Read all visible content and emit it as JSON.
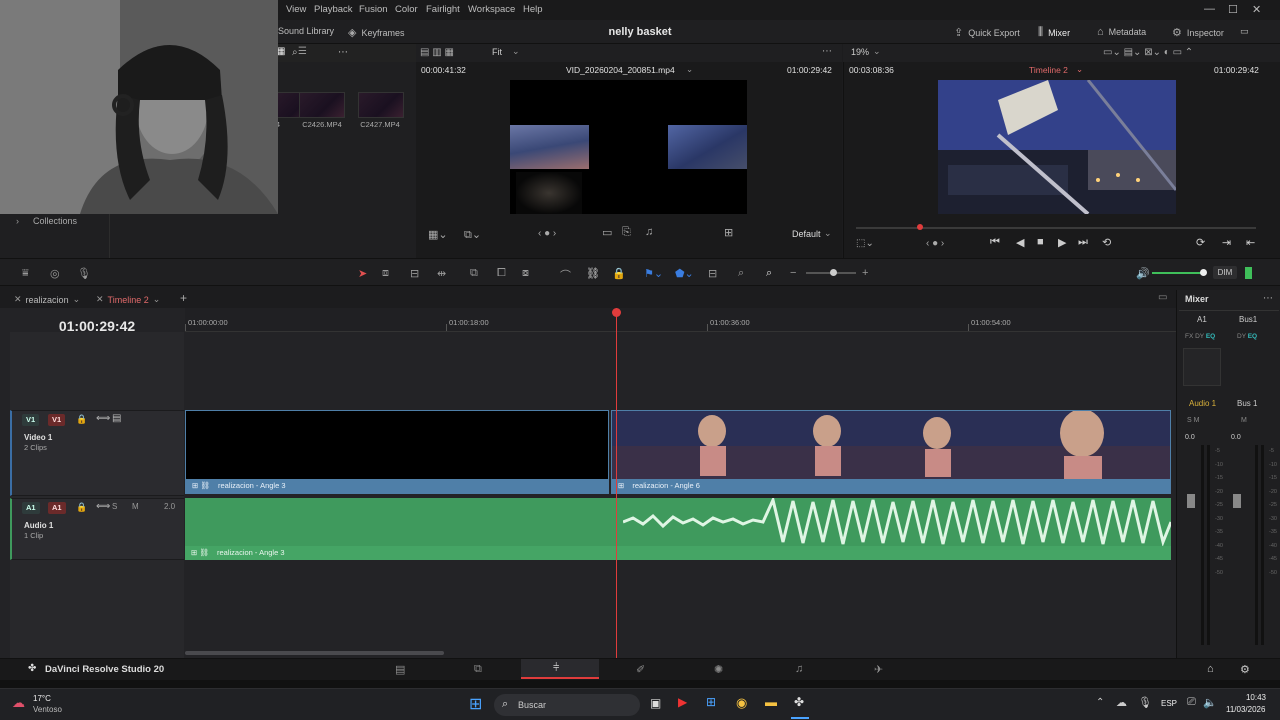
{
  "menu": [
    "View",
    "Playback",
    "Fusion",
    "Color",
    "Fairlight",
    "Workspace",
    "Help"
  ],
  "toolbar": {
    "sound_library": "Sound Library",
    "keyframes": "Keyframes",
    "project_title": "nelly basket",
    "quick_export": "Quick Export",
    "mixer": "Mixer",
    "metadata": "Metadata",
    "inspector": "Inspector",
    "fit": "Fit",
    "zoom": "19%"
  },
  "media_pool": {
    "clips": [
      {
        "name": "4"
      },
      {
        "name": "C2426.MP4"
      },
      {
        "name": "C2427.MP4"
      }
    ],
    "collections_label": "Collections"
  },
  "source_viewer": {
    "timecode_left": "00:00:41:32",
    "clip_name": "VID_20260204_200851.mp4",
    "timecode_right": "01:00:29:42",
    "display_mode": "Default"
  },
  "record_viewer": {
    "timecode_left": "00:03:08:36",
    "timeline_name": "Timeline 2",
    "timecode_right": "01:00:29:42",
    "audio_level": "DIM"
  },
  "timeline_tabs": [
    {
      "label": "realizacion",
      "active": false
    },
    {
      "label": "Timeline 2",
      "active": true
    }
  ],
  "timeline": {
    "timecode": "01:00:29:42",
    "ruler": [
      "01:00:00:00",
      "01:00:18:00",
      "01:00:36:00",
      "01:00:54:00"
    ],
    "tracks": {
      "video": {
        "id": "V1",
        "name": "Video 1",
        "sub": "2 Clips"
      },
      "audio": {
        "id": "A1",
        "name": "Audio 1",
        "sub": "1 Clip",
        "level": "2.0"
      }
    },
    "clips": {
      "video_1": "realizacion - Angle 3",
      "video_2": "realizacion - Angle 6",
      "audio_1": "realizacion - Angle 3"
    }
  },
  "mixer": {
    "title": "Mixer",
    "channels": [
      {
        "label": "A1",
        "name": "Audio 1",
        "level": "0.0"
      },
      {
        "label": "Bus1",
        "name": "Bus 1",
        "level": "0.0"
      }
    ],
    "scale": [
      "-5",
      "-10",
      "-15",
      "-20",
      "-25",
      "-30",
      "-35",
      "-40",
      "-45",
      "-50"
    ]
  },
  "footer": {
    "app_name": "DaVinci Resolve Studio 20"
  },
  "taskbar": {
    "weather_temp": "17°C",
    "weather_desc": "Ventoso",
    "search_placeholder": "Buscar",
    "language": "ESP",
    "time": "10:43",
    "date": "11/03/2026"
  }
}
